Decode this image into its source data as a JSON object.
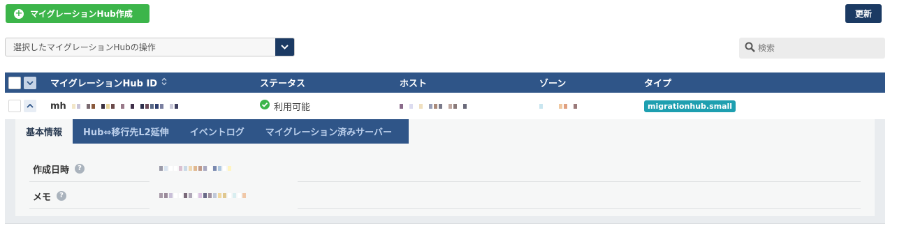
{
  "toolbar": {
    "create_label": "マイグレーションHub作成",
    "refresh_label": "更新"
  },
  "operations": {
    "selected": "選択したマイグレーションHubの操作"
  },
  "search": {
    "placeholder": "検索"
  },
  "table": {
    "columns": [
      "マイグレーションHub ID",
      "ステータス",
      "ホスト",
      "ゾーン",
      "タイプ"
    ],
    "rows": [
      {
        "id_prefix": "mh",
        "status": "利用可能",
        "type": "migrationhub.small"
      }
    ]
  },
  "detail": {
    "tabs": [
      "基本情報",
      "Hub⇔移行先L2延伸",
      "イベントログ",
      "マイグレーション済みサーバー"
    ],
    "fields": [
      {
        "label": "作成日時"
      },
      {
        "label": "メモ"
      }
    ]
  },
  "colors": {
    "primary": "#1b3a63",
    "header": "#2f5588",
    "success": "#3cb54a",
    "badge": "#1e9fb0"
  }
}
